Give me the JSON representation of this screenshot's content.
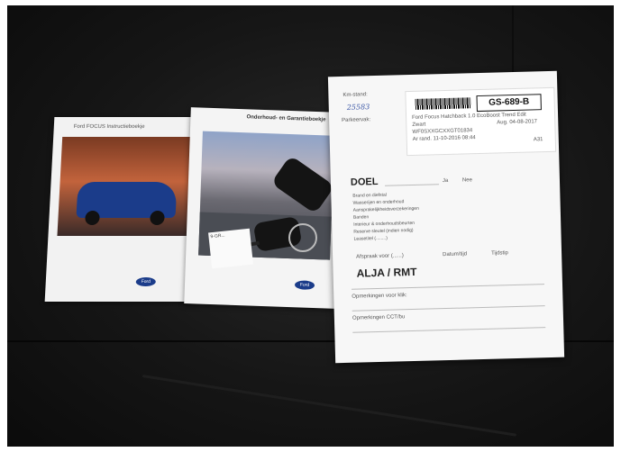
{
  "photo": {
    "description_labels": {
      "booklet1_title": "Ford FOCUS Instructieboekje",
      "booklet2_title": "Onderhoud- en Garantieboekje",
      "keytag_text": "9-GR..."
    }
  },
  "form": {
    "kmstand_label": "Km-stand:",
    "kmstand_value": "25583",
    "parkeervak_label": "Parkeervak:",
    "plate": "GS-689-B",
    "label_lines": [
      "Ford Focus Hatchback 1.0 EcoBoost Trend Edit",
      "Zwart",
      "WF0SXXGCXXGT01834",
      "Ar rand. 11-10-2016 08:44"
    ],
    "date": "Aug. 04-08-2017",
    "doc_id": "A31",
    "doel": "DOEL",
    "items": [
      "Brand en diefstal",
      "Wasserijen en onderhoud",
      "Aansprakelijkheidsverzekeringen",
      "Banden",
      "Interieur & onderhoudsbeurten",
      "Reserve sleutel (indien nodig)",
      "Leasetitel (........)"
    ],
    "ja": "Ja",
    "nee": "Nee",
    "afsprakenvoor": "Afspraak voor (......)",
    "datum": "Datum/tijd",
    "tijdstip": "Tijdstip",
    "alja": "ALJA / RMT",
    "opmerkingen1": "Opmerkingen voor klik:",
    "opmerkingen2": "Opmerkingen CCT/bu"
  }
}
